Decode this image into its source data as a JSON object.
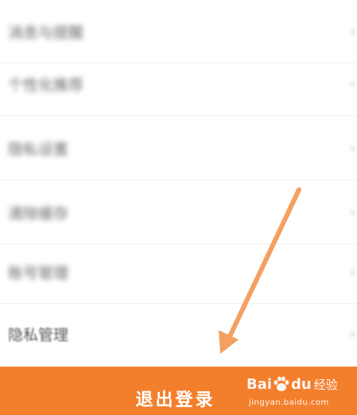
{
  "settings": {
    "items": [
      {
        "label": "消息与提醒"
      },
      {
        "label": "个性化推荐"
      },
      {
        "label": "隐私设置"
      },
      {
        "label": "清除缓存"
      },
      {
        "label": "账号管理"
      },
      {
        "label": "隐私管理"
      }
    ]
  },
  "logout": {
    "label": "退出登录"
  },
  "watermark": {
    "brand_bai": "Bai",
    "brand_du": "du",
    "brand_jingyan": "经验",
    "url": "jingyan.baidu.com"
  },
  "annotation": {
    "arrow_color": "#f4a061"
  },
  "colors": {
    "accent": "#f37f2d",
    "background": "#ffffff",
    "text": "#555555"
  }
}
